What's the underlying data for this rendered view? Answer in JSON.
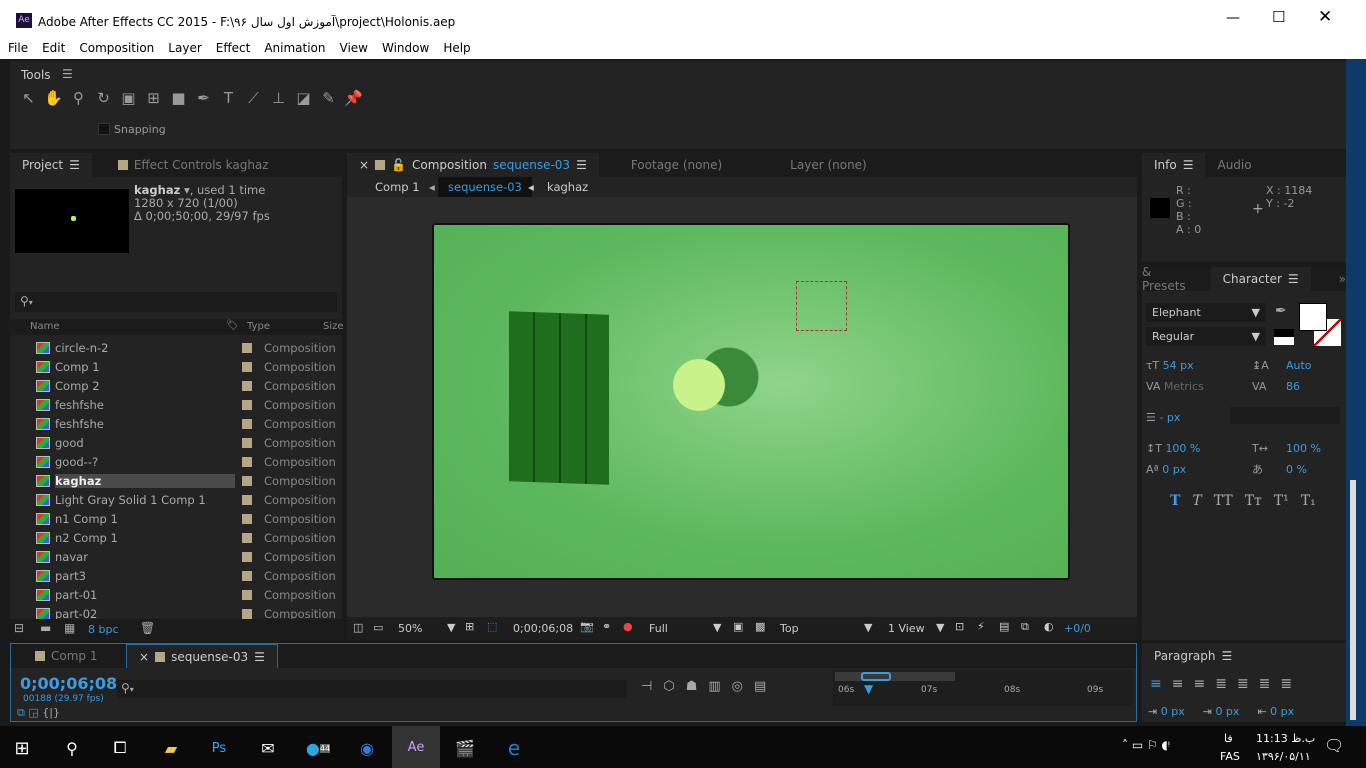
{
  "window": {
    "title": "Adobe After Effects CC 2015 - F:\\آموزش اول سال ۹۶\\project\\Holonis.aep",
    "app_icon": "Ae",
    "controls": [
      "minimize",
      "maximize",
      "close"
    ]
  },
  "menu": [
    "File",
    "Edit",
    "Composition",
    "Layer",
    "Effect",
    "Animation",
    "View",
    "Window",
    "Help"
  ],
  "tools": {
    "title": "Tools",
    "snapping": "Snapping",
    "icons": [
      "selection-icon",
      "hand-icon",
      "zoom-icon",
      "rotate-icon",
      "camera-icon",
      "pan-behind-icon",
      "rectangle-icon",
      "pen-icon",
      "type-icon",
      "brush-icon",
      "clone-stamp-icon",
      "eraser-icon",
      "roto-brush-icon",
      "puppet-pin-icon"
    ]
  },
  "project": {
    "tab": "Project",
    "effect_tab": "Effect Controls kaghaz",
    "item_name": "kaghaz",
    "used": ", used 1 time",
    "dims": "1280 x 720 (1/00)",
    "duration": "Δ 0;00;50;00, 29/97 fps",
    "columns": [
      "Name",
      "Type",
      "Size"
    ],
    "items": [
      {
        "name": "circle-n-2",
        "type": "Composition"
      },
      {
        "name": "Comp 1",
        "type": "Composition"
      },
      {
        "name": "Comp 2",
        "type": "Composition"
      },
      {
        "name": "feshfshe",
        "type": "Composition"
      },
      {
        "name": "feshfshe",
        "type": "Composition"
      },
      {
        "name": "good",
        "type": "Composition"
      },
      {
        "name": "good--?",
        "type": "Composition"
      },
      {
        "name": "kaghaz",
        "type": "Composition",
        "selected": true
      },
      {
        "name": "Light Gray Solid 1 Comp 1",
        "type": "Composition"
      },
      {
        "name": "n1 Comp 1",
        "type": "Composition"
      },
      {
        "name": "n2 Comp 1",
        "type": "Composition"
      },
      {
        "name": "navar",
        "type": "Composition"
      },
      {
        "name": "part3",
        "type": "Composition"
      },
      {
        "name": "part-01",
        "type": "Composition"
      },
      {
        "name": "part-02",
        "type": "Composition"
      }
    ],
    "bpc": "8 bpc"
  },
  "comp": {
    "tab_prefix": "Composition",
    "tab_name": "sequense-03",
    "footage_tab": "Footage (none)",
    "layer_tab": "Layer (none)",
    "breadcrumbs": [
      "Comp 1",
      "sequense-03",
      "kaghaz"
    ],
    "zoom": "50%",
    "timecode": "0;00;06;08",
    "resolution": "Full",
    "view": "Top",
    "views": "1 View",
    "exposure": "+0/0",
    "bg_color": "#5cb85c"
  },
  "info": {
    "tab": "Info",
    "audio_tab": "Audio",
    "r": "R :",
    "g": "G :",
    "b": "B :",
    "a": "A : 0",
    "x": "X : 1184",
    "y": "Y : -2"
  },
  "character": {
    "presets_tab": "& Presets",
    "tab": "Character",
    "font": "Elephant",
    "style": "Regular",
    "size": "54 px",
    "leading": "Auto",
    "kerning": "Metrics",
    "tracking": "86",
    "stroke": "- px",
    "vscale": "100 %",
    "hscale": "100 %",
    "baseline": "0 px",
    "tsume": "0 %",
    "styles": [
      "T",
      "T",
      "TT",
      "Tт",
      "T¹",
      "T₁"
    ]
  },
  "timeline": {
    "tabs": [
      "Comp 1",
      "sequense-03"
    ],
    "timecode": "0;00;06;08",
    "frames": "00188 (29.97 fps)",
    "ruler": [
      "06s",
      "07s",
      "08s",
      "09s"
    ]
  },
  "paragraph": {
    "tab": "Paragraph",
    "indents": [
      "0 px",
      "0 px",
      "0 px"
    ]
  },
  "taskbar": {
    "apps": [
      "file-explorer",
      "photoshop",
      "mail",
      "telegram",
      "eagle",
      "after-effects",
      "clapper",
      "edge"
    ],
    "telegram_badge": "44",
    "time": "11:13 ب.ظ",
    "date": "۱۳۹۶/۰۵/۱۱",
    "lang": "FAS",
    "lang2": "فا"
  }
}
